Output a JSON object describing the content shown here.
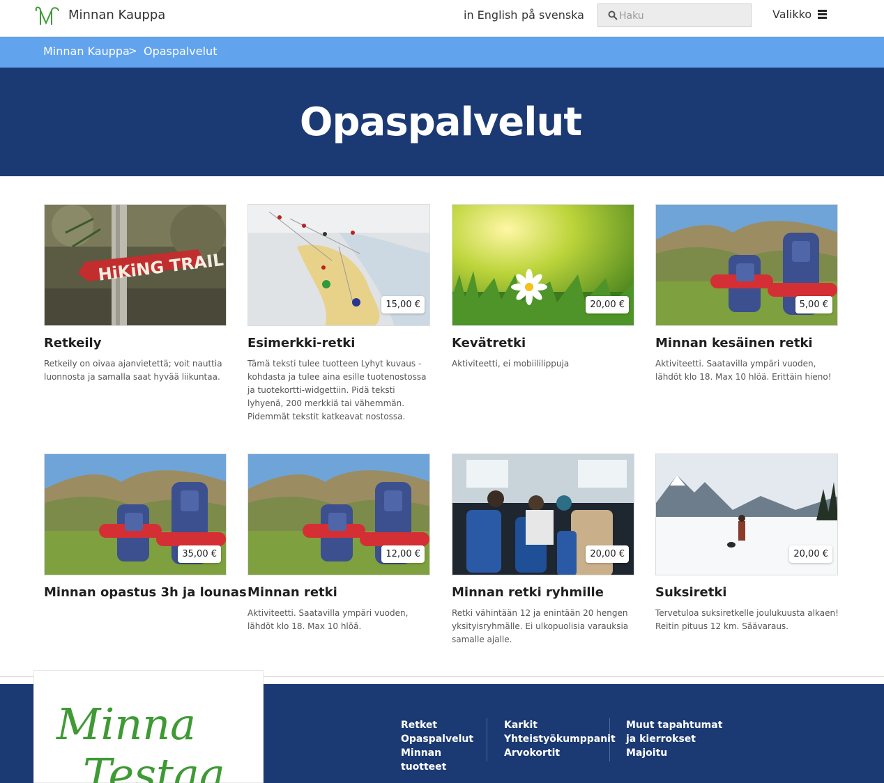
{
  "header": {
    "site_title": "Minnan Kauppa",
    "lang_en": "in English",
    "lang_sv": "på svenska",
    "search_placeholder": "Haku",
    "menu_label": "Valikko"
  },
  "breadcrumb": {
    "home": "Minnan Kauppa",
    "separator": ">",
    "current": "Opaspalvelut"
  },
  "hero": {
    "title": "Opaspalvelut"
  },
  "products": [
    {
      "title": "Retkeily",
      "price": "",
      "description": "Retkeily on oivaa ajanvietettä; voit nauttia luonnosta ja samalla saat hyvää liikuntaa."
    },
    {
      "title": "Esimerkki-retki",
      "price": "15,00 €",
      "description": "Tämä teksti tulee tuotteen Lyhyt kuvaus -kohdasta ja tulee aina esille tuotenostossa ja tuotekortti-widgettiin. Pidä teksti lyhyenä, 200 merkkiä tai vähemmän. Pidemmät tekstit katkeavat nostossa."
    },
    {
      "title": "Kevätretki",
      "price": "20,00 €",
      "description": "Aktiviteetti, ei mobiililippuja"
    },
    {
      "title": "Minnan kesäinen retki",
      "price": "5,00 €",
      "description": "Aktiviteetti. Saatavilla ympäri vuoden, lähdöt klo 18. Max 10 hlöä. Erittäin hieno!"
    },
    {
      "title": "Minnan opastus 3h ja lounas",
      "price": "35,00 €",
      "description": ""
    },
    {
      "title": "Minnan retki",
      "price": "12,00 €",
      "description": "Aktiviteetti. Saatavilla ympäri vuoden, lähdöt klo 18. Max 10 hlöä."
    },
    {
      "title": "Minnan retki ryhmille",
      "price": "20,00 €",
      "description": "Retki vähintään 12 ja enintään 20 hengen yksityisryhmälle. Ei ulkopuolisia varauksia samalle ajalle."
    },
    {
      "title": "Suksiretki",
      "price": "20,00 €",
      "description": "Tervetuloa suksiretkelle joulukuusta alkaen! Reitin pituus 12 km. Säävaraus."
    }
  ],
  "images": {
    "hiking_sign_text": "HiKiNG TRAIL"
  },
  "footer": {
    "logo_line1": "Minna",
    "logo_line2": "Testaa",
    "col1": [
      "Retket",
      "Opaspalvelut",
      "Minnan tuotteet"
    ],
    "col2": [
      "Karkit",
      "Yhteistyökumppanit",
      "Arvokortit"
    ],
    "col3": [
      "Muut tapahtumat ja kierrokset",
      "Majoitu"
    ]
  },
  "colors": {
    "brand_navy": "#1b3a73",
    "breadcrumb_blue": "#62a3ee",
    "logo_green": "#3f9a35"
  }
}
